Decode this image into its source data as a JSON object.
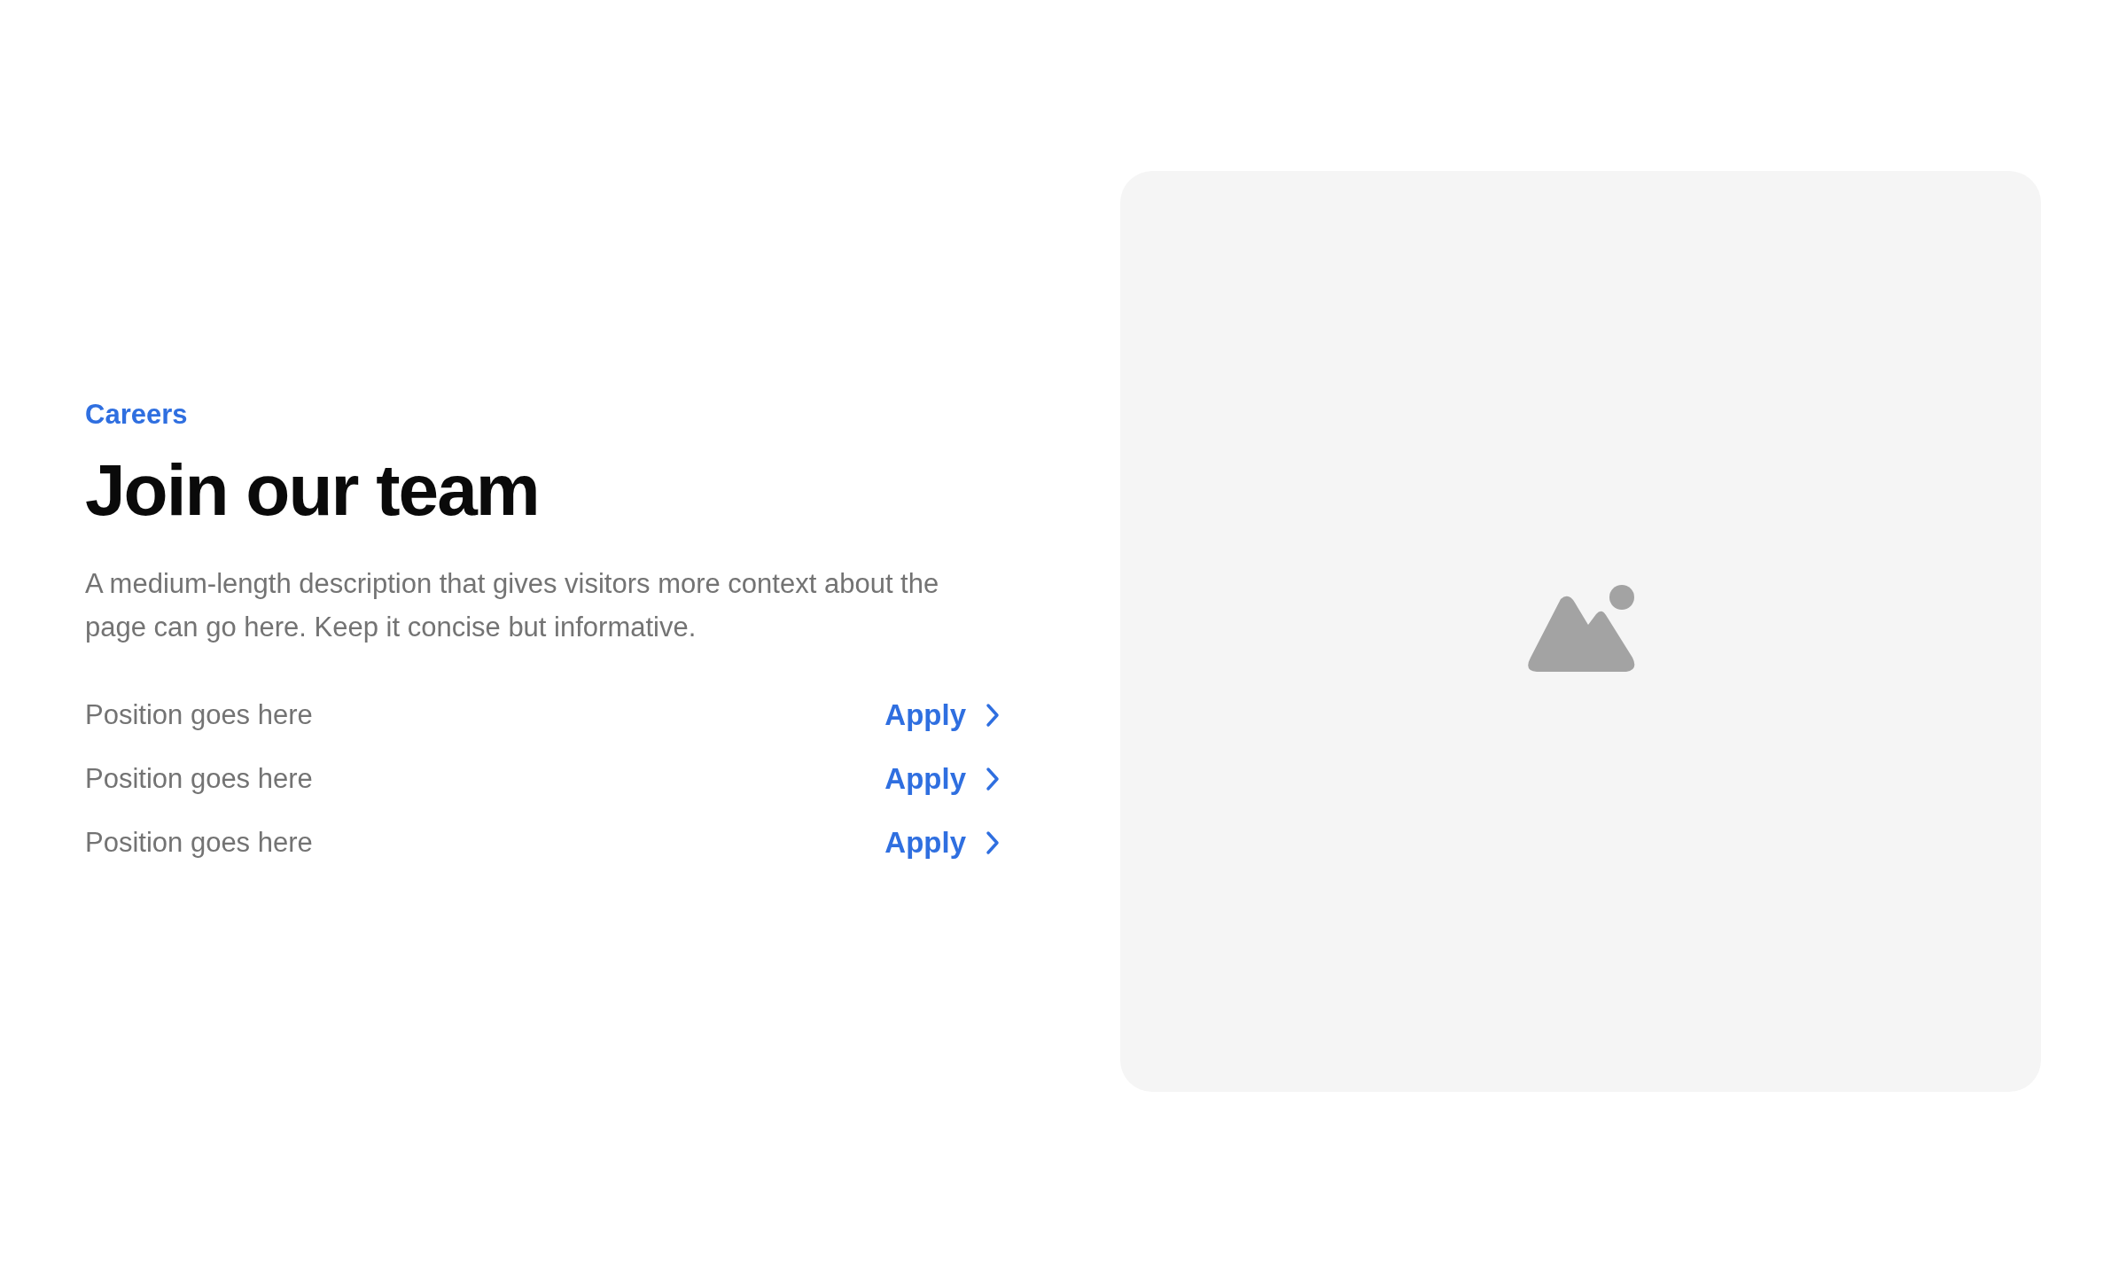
{
  "eyebrow": "Careers",
  "heading": "Join our team",
  "description": "A medium-length description that gives visitors more context about the page can go here. Keep it concise but informative.",
  "positions": [
    {
      "title": "Position goes here",
      "action": "Apply"
    },
    {
      "title": "Position goes here",
      "action": "Apply"
    },
    {
      "title": "Position goes here",
      "action": "Apply"
    }
  ],
  "media": {
    "kind": "placeholder"
  }
}
